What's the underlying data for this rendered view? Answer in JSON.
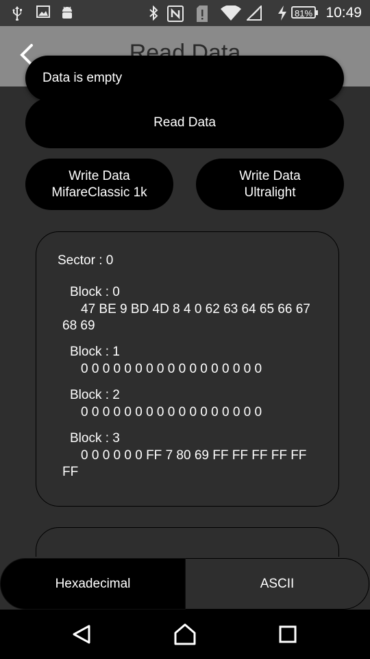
{
  "status_bar": {
    "time": "10:49",
    "battery": "81%",
    "icons": [
      "usb-icon",
      "image-icon",
      "android-icon",
      "bluetooth-icon",
      "nfc-icon",
      "sim-alert-icon",
      "wifi-icon",
      "signal-icon",
      "charging-icon"
    ]
  },
  "app_bar": {
    "title": "Read Data"
  },
  "toast": {
    "text": "Data is empty"
  },
  "buttons": {
    "read": "Read Data",
    "write_classic": "Write Data\nMifareClassic 1k",
    "write_ultralight": "Write Data\nUltralight"
  },
  "card": {
    "sector": "Sector : 0",
    "blocks": [
      {
        "title": "Block : 0",
        "data": "47 BE 9 BD 4D 8 4 0 62 63 64 65 66 67 68 69"
      },
      {
        "title": "Block : 1",
        "data": "0 0 0 0 0 0 0 0 0 0 0 0 0 0 0 0 0"
      },
      {
        "title": "Block : 2",
        "data": "0 0 0 0 0 0 0 0 0 0 0 0 0 0 0 0 0"
      },
      {
        "title": "Block : 3",
        "data": "0 0 0 0 0 0 FF 7 80 69 FF FF FF FF FF FF"
      }
    ]
  },
  "tabs": {
    "hex": "Hexadecimal",
    "ascii": "ASCII",
    "selected": "Hexadecimal"
  },
  "colors": {
    "background": "#2e2e2e",
    "appbar": "#8a8a8a",
    "button": "#000000"
  }
}
